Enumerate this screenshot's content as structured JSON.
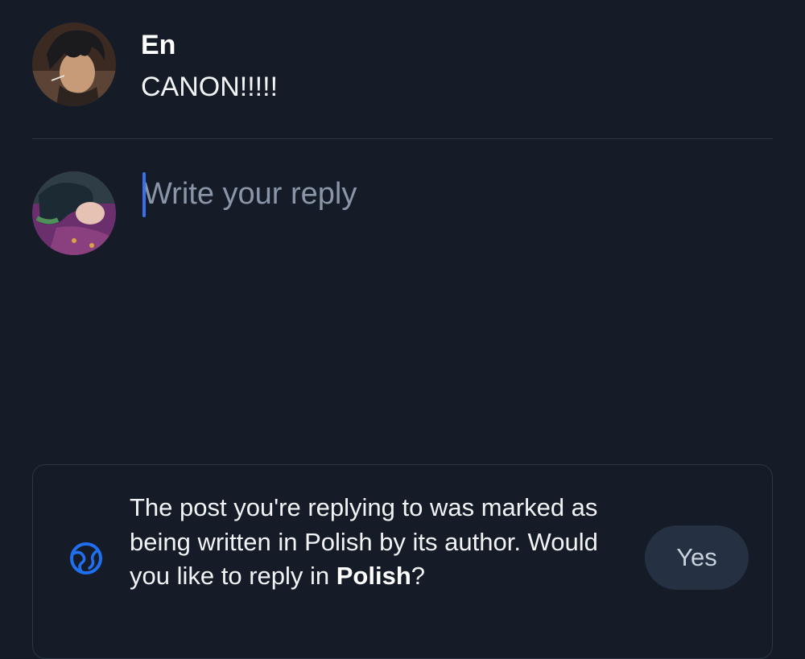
{
  "parent_post": {
    "author_name": "En",
    "text": "CANON!!!!!",
    "avatar_icon": "author-avatar"
  },
  "reply": {
    "placeholder": "Write your reply",
    "value": "",
    "avatar_icon": "user-avatar"
  },
  "language_banner": {
    "message_before": "The post you're replying to was marked as being written in Polish by its author. Would you like to reply in ",
    "language": "Polish",
    "message_after": "?",
    "icon": "globe-icon",
    "yes_label": "Yes",
    "accent_color": "#1f6ff0"
  },
  "colors": {
    "background": "#151c27",
    "divider": "#2b3544",
    "button_bg": "#253042",
    "caret": "#3c6fe8"
  }
}
